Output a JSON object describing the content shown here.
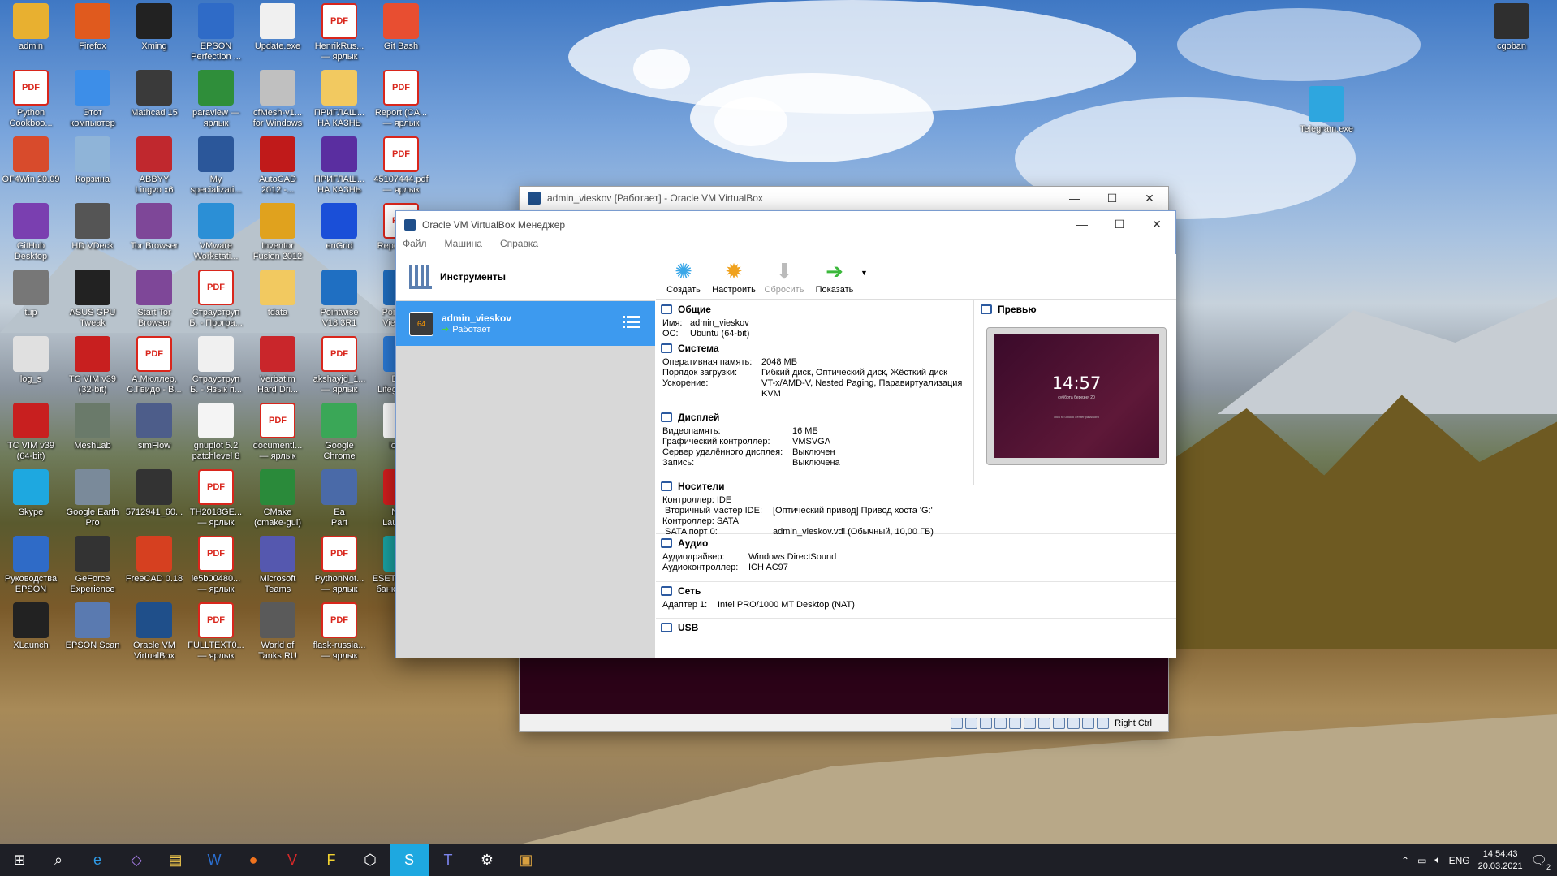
{
  "desktop_icons": [
    {
      "label": "admin",
      "icon": "user-folder-icon",
      "color": "#e8b030"
    },
    {
      "label": "Firefox",
      "icon": "firefox-icon",
      "color": "#e05a1e"
    },
    {
      "label": "Xming",
      "icon": "xming-icon",
      "color": "#222222"
    },
    {
      "label": "EPSON\nPerfection ...",
      "icon": "scanner-icon",
      "color": "#2f6bc7"
    },
    {
      "label": "Update.exe",
      "icon": "exe-icon",
      "color": "#f0f0f0"
    },
    {
      "label": "HenrikRus...\n— ярлык",
      "icon": "pdf-icon",
      "color": "#d9261c"
    },
    {
      "label": "Git Bash",
      "icon": "git-icon",
      "color": "#e84e31"
    },
    {
      "label": "Python\nCookboo...",
      "icon": "pdf-icon",
      "color": "#d9261c"
    },
    {
      "label": "Этот\nкомпьютер",
      "icon": "computer-icon",
      "color": "#3d8ee8"
    },
    {
      "label": "Mathcad 15",
      "icon": "mathcad-icon",
      "color": "#3a3a3a"
    },
    {
      "label": "paraview —\nярлык",
      "icon": "paraview-icon",
      "color": "#2f8e3a"
    },
    {
      "label": "cfMesh-v1...\nfor Windows",
      "icon": "gear-file-icon",
      "color": "#c0c0c0"
    },
    {
      "label": "ПРИГЛАШ...\nНА КАЗНЬ",
      "icon": "folder-icon",
      "color": "#f2c960"
    },
    {
      "label": "Report (CA...\n— ярлык",
      "icon": "pdf-icon",
      "color": "#d9261c"
    },
    {
      "label": "OF4Win 20.09",
      "icon": "of4win-icon",
      "color": "#d84b2c"
    },
    {
      "label": "Корзина",
      "icon": "recycle-bin-icon",
      "color": "#8fb4d8"
    },
    {
      "label": "ABBYY\nLingvo x6",
      "icon": "abbyy-icon",
      "color": "#c0282e"
    },
    {
      "label": "My\nspecializati...",
      "icon": "word-icon",
      "color": "#2b579a"
    },
    {
      "label": "AutoCAD\n2012 -...",
      "icon": "autocad-icon",
      "color": "#c01a1a"
    },
    {
      "label": "ПРИГЛАШ...\nНА КАЗНЬ",
      "icon": "firefox-doc-icon",
      "color": "#5a2ea0"
    },
    {
      "label": "45107444.pdf\n— ярлык",
      "icon": "pdf-icon",
      "color": "#d9261c"
    },
    {
      "label": "GitHub\nDesktop",
      "icon": "github-icon",
      "color": "#7a3fb0"
    },
    {
      "label": "HD VDeck",
      "icon": "hdvdeck-icon",
      "color": "#555555"
    },
    {
      "label": "Tor Browser",
      "icon": "tor-icon",
      "color": "#7e4798"
    },
    {
      "label": "VMware\nWorkstati...",
      "icon": "vmware-icon",
      "color": "#2b8fd6"
    },
    {
      "label": "Inventor\nFusion 2012",
      "icon": "inventor-icon",
      "color": "#e0a21e"
    },
    {
      "label": "enGrid",
      "icon": "engrid-icon",
      "color": "#1a4fd8"
    },
    {
      "label": "ReportAM...",
      "icon": "pdf-icon",
      "color": "#d9261c"
    },
    {
      "label": "tup",
      "icon": "generic-icon",
      "color": "#777777"
    },
    {
      "label": "ASUS GPU\nTweak",
      "icon": "gpu-tweak-icon",
      "color": "#222222"
    },
    {
      "label": "Start Tor\nBrowser",
      "icon": "tor-icon",
      "color": "#7e4798"
    },
    {
      "label": "Страуструп\nБ. - Програ...",
      "icon": "pdf-icon",
      "color": "#d9261c"
    },
    {
      "label": "tdata",
      "icon": "folder-icon",
      "color": "#f2c960"
    },
    {
      "label": "Pointwise\nV18.3R1",
      "icon": "pointwise-icon",
      "color": "#1f6fc2"
    },
    {
      "label": "Pointwise\nViewer ...",
      "icon": "pointwise-icon",
      "color": "#1f6fc2"
    },
    {
      "label": "log_s",
      "icon": "text-file-icon",
      "color": "#e0e0e0"
    },
    {
      "label": "TC VIM v39\n(32-bit)",
      "icon": "vim-icon",
      "color": "#c81f1f"
    },
    {
      "label": "А.Мюллер,\nС.Гвидо - В...",
      "icon": "pdf-icon",
      "color": "#d9261c"
    },
    {
      "label": "Страуструп\nБ. - Язык п...",
      "icon": "text-file-icon",
      "color": "#f0f0f0"
    },
    {
      "label": "Verbatim\nHard Dri...",
      "icon": "verbatim-icon",
      "color": "#c9262b"
    },
    {
      "label": "akshayjd_1...\n— ярлык",
      "icon": "pdf-icon",
      "color": "#d9261c"
    },
    {
      "label": "Data\nLifeguard ...",
      "icon": "data-lifeguard-icon",
      "color": "#2b7ad6"
    },
    {
      "label": "TC VIM v39\n(64-bit)",
      "icon": "vim-icon",
      "color": "#c81f1f"
    },
    {
      "label": "MeshLab",
      "icon": "meshlab-icon",
      "color": "#6a7a6a"
    },
    {
      "label": "simFlow",
      "icon": "simflow-icon",
      "color": "#4d5d8a"
    },
    {
      "label": "gnuplot 5.2\npatchlevel 8",
      "icon": "gnuplot-icon",
      "color": "#f4f4f4"
    },
    {
      "label": "document!...\n— ярлык",
      "icon": "pdf-icon",
      "color": "#d9261c"
    },
    {
      "label": "Google\nChrome",
      "icon": "chrome-icon",
      "color": "#3aa757"
    },
    {
      "label": "log.txt",
      "icon": "text-file-icon",
      "color": "#ffffff"
    },
    {
      "label": "Skype",
      "icon": "skype-icon",
      "color": "#1ea8e0"
    },
    {
      "label": "Google Earth\nPro",
      "icon": "google-earth-icon",
      "color": "#7a8a9a"
    },
    {
      "label": "5712941_60...",
      "icon": "image-file-icon",
      "color": "#333333"
    },
    {
      "label": "TH2018GE...\n— ярлык",
      "icon": "pdf-icon",
      "color": "#d9261c"
    },
    {
      "label": "CMake\n(cmake-gui)",
      "icon": "cmake-icon",
      "color": "#2a8a3a"
    },
    {
      "label": "Ea\nPart",
      "icon": "generic-icon",
      "color": "#4a6aa8"
    },
    {
      "label": "Nero\nLauncher",
      "icon": "nero-icon",
      "color": "#d61e1e"
    },
    {
      "label": "Руководства\nEPSON",
      "icon": "epson-guide-icon",
      "color": "#2f6bc7"
    },
    {
      "label": "GeForce\nExperience",
      "icon": "geforce-icon",
      "color": "#333333"
    },
    {
      "label": "FreeCAD 0.18",
      "icon": "freecad-icon",
      "color": "#d64020"
    },
    {
      "label": "ie5b00480...\n— ярлык",
      "icon": "pdf-icon",
      "color": "#d9261c"
    },
    {
      "label": "Microsoft\nTeams",
      "icon": "teams-icon",
      "color": "#5558af"
    },
    {
      "label": "PythonNot...\n— ярлык",
      "icon": "pdf-icon",
      "color": "#d9261c"
    },
    {
      "label": "ESET Защита\nбанковско...",
      "icon": "eset-icon",
      "color": "#1aa3a3"
    },
    {
      "label": "XLaunch",
      "icon": "xlaunch-icon",
      "color": "#222222"
    },
    {
      "label": "EPSON Scan",
      "icon": "epson-scan-icon",
      "color": "#5a7ab0"
    },
    {
      "label": "Oracle VM\nVirtualBox",
      "icon": "virtualbox-icon",
      "color": "#1f4f8a"
    },
    {
      "label": "FULLTEXT0...\n— ярлык",
      "icon": "pdf-icon",
      "color": "#d9261c"
    },
    {
      "label": "World of\nTanks RU",
      "icon": "wot-icon",
      "color": "#5a5a5a"
    },
    {
      "label": "flask-russia...\n— ярлык",
      "icon": "pdf-icon",
      "color": "#d9261c"
    },
    {
      "label": "cgoban",
      "icon": "cgoban-icon",
      "color": "#2f2f2f"
    },
    {
      "label": "Telegram.exe",
      "icon": "telegram-icon",
      "color": "#2ea6df"
    }
  ],
  "vm_window": {
    "title": "admin_vieskov [Работает] - Oracle VM VirtualBox",
    "host_key": "Right Ctrl"
  },
  "manager": {
    "title": "Oracle VM VirtualBox Менеджер",
    "menu": [
      "Файл",
      "Машина",
      "Справка"
    ],
    "tools_label": "Инструменты",
    "vm_name": "admin_vieskov",
    "vm_state": "Работает",
    "toolbar": [
      {
        "label": "Создать",
        "icon": "create-icon",
        "enabled": true
      },
      {
        "label": "Настроить",
        "icon": "settings-gear-icon",
        "enabled": true
      },
      {
        "label": "Сбросить",
        "icon": "discard-icon",
        "enabled": false
      },
      {
        "label": "Показать",
        "icon": "show-arrow-icon",
        "enabled": true
      }
    ],
    "sections": {
      "general": {
        "title": "Общие",
        "rows": [
          [
            "Имя:",
            "admin_vieskov"
          ],
          [
            "ОС:",
            "Ubuntu (64-bit)"
          ]
        ]
      },
      "system": {
        "title": "Система",
        "rows": [
          [
            "Оперативная память:",
            "2048 МБ"
          ],
          [
            "Порядок загрузки:",
            "Гибкий диск, Оптический диск, Жёсткий диск"
          ],
          [
            "Ускорение:",
            "VT-x/AMD-V, Nested Paging, Паравиртуализация KVM"
          ]
        ]
      },
      "display": {
        "title": "Дисплей",
        "rows": [
          [
            "Видеопамять:",
            "16 МБ"
          ],
          [
            "Графический контроллер:",
            "VMSVGA"
          ],
          [
            "Сервер удалённого дисплея:",
            "Выключен"
          ],
          [
            "Запись:",
            "Выключена"
          ]
        ]
      },
      "storage": {
        "title": "Носители",
        "rows": [
          [
            "Контроллер: IDE",
            ""
          ],
          [
            " Вторичный мастер IDE:",
            "[Оптический привод] Привод хоста 'G:'"
          ],
          [
            "Контроллер: SATA",
            ""
          ],
          [
            " SATA порт 0:",
            "admin_vieskov.vdi (Обычный, 10,00 ГБ)"
          ]
        ]
      },
      "audio": {
        "title": "Аудио",
        "rows": [
          [
            "Аудиодрайвер:",
            "Windows DirectSound"
          ],
          [
            "Аудиоконтроллер:",
            "ICH AC97"
          ]
        ]
      },
      "network": {
        "title": "Сеть",
        "rows": [
          [
            "Адаптер 1:",
            "Intel PRO/1000 MT Desktop (NAT)"
          ]
        ]
      },
      "usb": {
        "title": "USB"
      }
    },
    "preview": {
      "title": "Превью",
      "clock": "14:57",
      "date_line": "суббота березня 20",
      "unlock_hint": "click to unlock / enter password"
    }
  },
  "taskbar": {
    "items": [
      {
        "icon": "windows-start-icon"
      },
      {
        "icon": "search-icon"
      },
      {
        "icon": "edge-icon"
      },
      {
        "icon": "visual-studio-icon"
      },
      {
        "icon": "file-explorer-icon"
      },
      {
        "icon": "word-icon"
      },
      {
        "icon": "firefox-icon"
      },
      {
        "icon": "vim-icon"
      },
      {
        "icon": "far-manager-icon"
      },
      {
        "icon": "virtualbox-icon"
      },
      {
        "icon": "skype-icon"
      },
      {
        "icon": "teams-icon"
      },
      {
        "icon": "settings-icon"
      },
      {
        "icon": "virtualbox-vm-icon"
      }
    ],
    "lang": "ENG",
    "time": "14:54:43",
    "date": "20.03.2021",
    "notification_count": "2"
  }
}
